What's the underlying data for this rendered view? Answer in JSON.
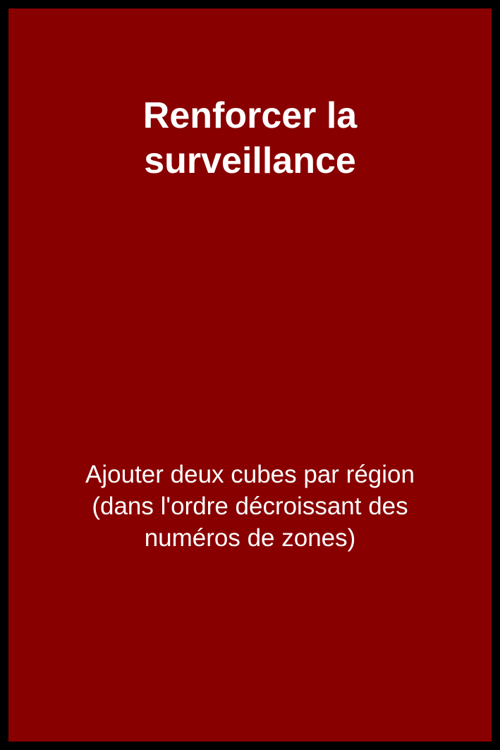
{
  "card": {
    "background_color": "#880000",
    "border_color": "#000000",
    "title_lines": [
      "Renforcer la",
      "surveillance"
    ],
    "description_lines": [
      "Ajouter deux cubes par région",
      "(dans l'ordre décroissant des",
      "numéros de zones)"
    ]
  }
}
